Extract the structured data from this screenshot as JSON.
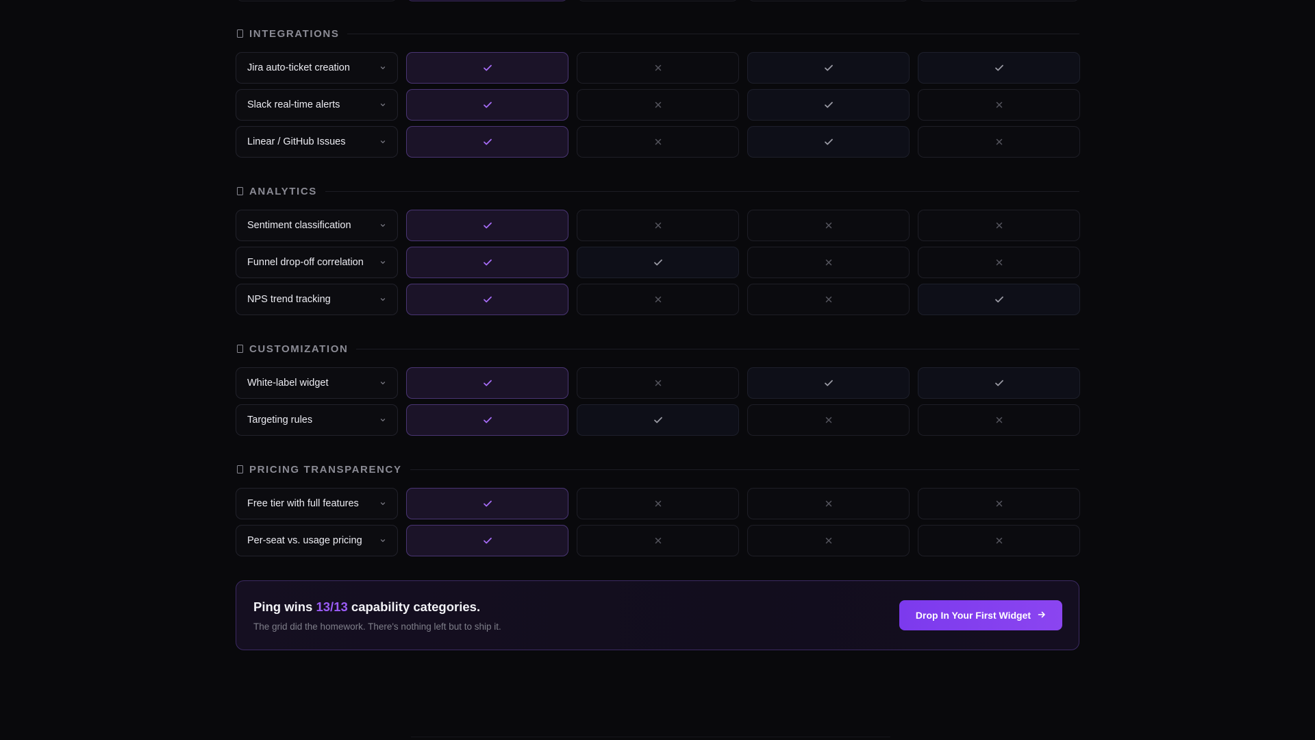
{
  "colors": {
    "accent": "#9b5cf6",
    "check_ping": "#a66cf7",
    "check_other": "#9a9aa4",
    "cross": "#55555e",
    "cta_button": "#7c3aed"
  },
  "icons": {
    "section": "folder-icon",
    "expand": "chevron-down-icon",
    "yes": "check-icon",
    "no": "x-icon",
    "cta_arrow": "arrow-right-icon"
  },
  "sections": [
    {
      "title": "INTEGRATIONS",
      "rows": [
        {
          "label": "Jira auto-ticket creation",
          "cols": [
            true,
            false,
            true,
            true
          ]
        },
        {
          "label": "Slack real-time alerts",
          "cols": [
            true,
            false,
            true,
            false
          ]
        },
        {
          "label": "Linear / GitHub Issues",
          "cols": [
            true,
            false,
            true,
            false
          ]
        }
      ]
    },
    {
      "title": "ANALYTICS",
      "rows": [
        {
          "label": "Sentiment classification",
          "cols": [
            true,
            false,
            false,
            false
          ]
        },
        {
          "label": "Funnel drop-off correlation",
          "cols": [
            true,
            true,
            false,
            false
          ]
        },
        {
          "label": "NPS trend tracking",
          "cols": [
            true,
            false,
            false,
            true
          ]
        }
      ]
    },
    {
      "title": "CUSTOMIZATION",
      "rows": [
        {
          "label": "White-label widget",
          "cols": [
            true,
            false,
            true,
            true
          ]
        },
        {
          "label": "Targeting rules",
          "cols": [
            true,
            true,
            false,
            false
          ]
        }
      ]
    },
    {
      "title": "PRICING TRANSPARENCY",
      "rows": [
        {
          "label": "Free tier with full features",
          "cols": [
            true,
            false,
            false,
            false
          ]
        },
        {
          "label": "Per-seat vs. usage pricing",
          "cols": [
            true,
            false,
            false,
            false
          ]
        }
      ]
    }
  ],
  "cta": {
    "title_prefix": "Ping wins ",
    "title_score": "13/13",
    "title_suffix": " capability categories.",
    "subtitle": "The grid did the homework. There's nothing left but to ship it.",
    "button_label": "Drop In Your First Widget"
  }
}
